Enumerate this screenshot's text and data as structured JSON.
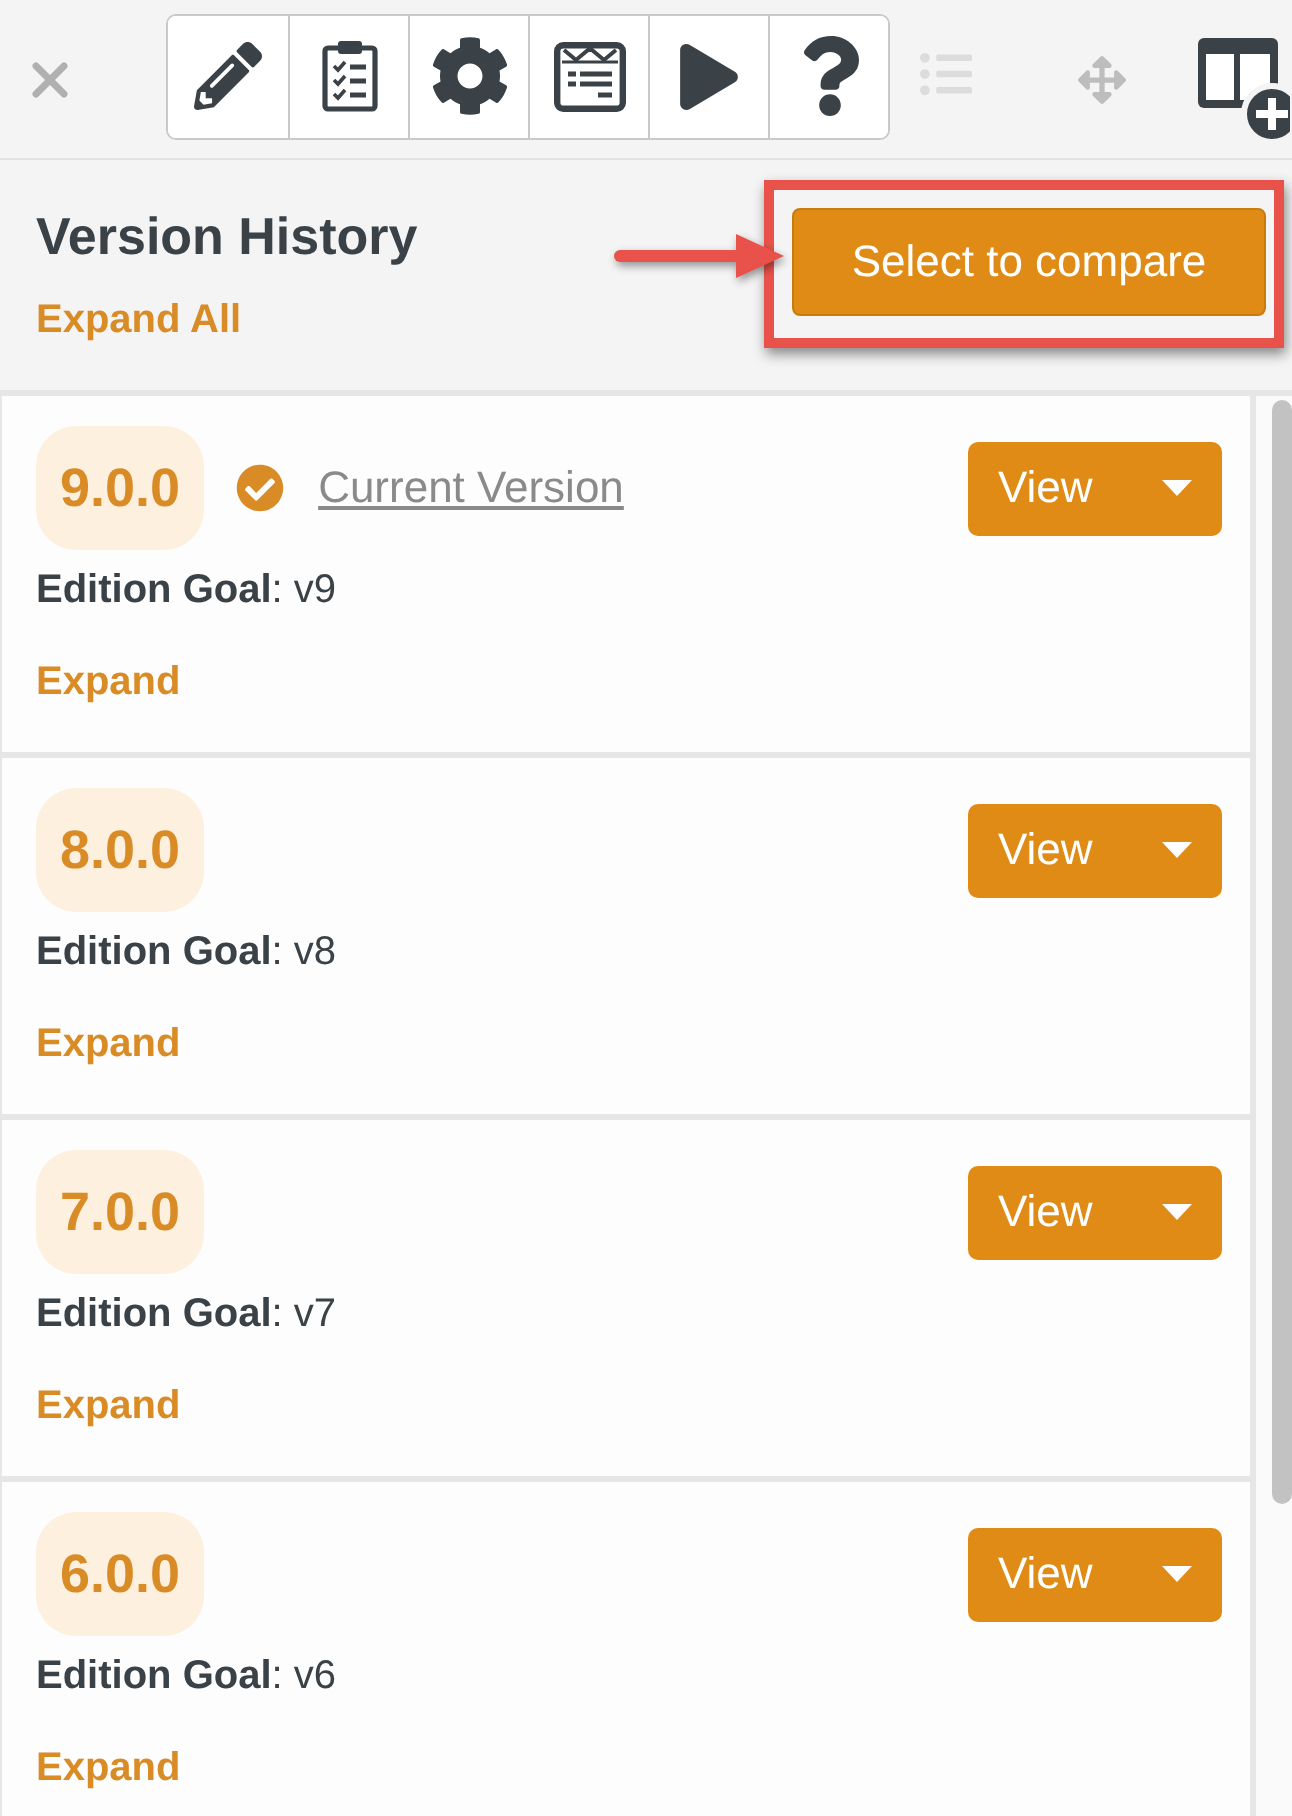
{
  "toolbar": {
    "list_tool": {
      "disabled": true
    }
  },
  "header": {
    "title": "Version History",
    "expand_all": "Expand All",
    "compare_button": "Select to compare"
  },
  "versions": [
    {
      "version": "9.0.0",
      "current": true,
      "current_label": "Current Version",
      "goal": "**Edition Goal**: v9",
      "view_button": "View",
      "expand": "Expand"
    },
    {
      "version": "8.0.0",
      "current": false,
      "goal": "**Edition Goal**: v8",
      "view_button": "View",
      "expand": "Expand"
    },
    {
      "version": "7.0.0",
      "current": false,
      "goal": "**Edition Goal**: v7",
      "view_button": "View",
      "expand": "Expand"
    },
    {
      "version": "6.0.0",
      "current": false,
      "goal": "**Edition Goal**: v6",
      "view_button": "View",
      "expand": "Expand"
    }
  ]
}
